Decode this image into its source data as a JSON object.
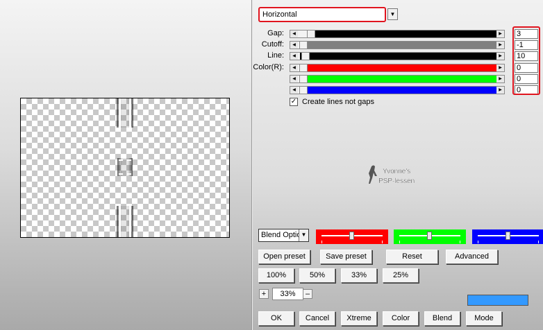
{
  "preset": {
    "selected": "Horizontal"
  },
  "sliders": [
    {
      "label": "Gap:",
      "value": "3",
      "position": 0.04,
      "fill": "#000000",
      "fill_from": "thumb"
    },
    {
      "label": "Cutoff:",
      "value": "-1",
      "position": 0.0,
      "fill": "#808080",
      "fill_from": "thumb"
    },
    {
      "label": "Line:",
      "value": "10",
      "position": 0.01,
      "fill": "#000000",
      "fill_from": "both"
    },
    {
      "label": "Color(R):",
      "value": "0",
      "position": 0.0,
      "fill": "#ff0000",
      "fill_from": "thumb"
    },
    {
      "label": "",
      "value": "0",
      "position": 0.0,
      "fill": "#00ff00",
      "fill_from": "thumb"
    },
    {
      "label": "",
      "value": "0",
      "position": 0.0,
      "fill": "#0000ff",
      "fill_from": "thumb"
    }
  ],
  "checkbox": {
    "label": "Create lines not gaps",
    "checked": true,
    "mark": "✓"
  },
  "watermark": {
    "line1": "Yvonne's",
    "line2": "PSP-lessen"
  },
  "blend": {
    "selected": "Blend Options"
  },
  "color_bars": [
    {
      "color": "#ff0000",
      "level": 0.5
    },
    {
      "color": "#00ff00",
      "level": 0.5
    },
    {
      "color": "#0000ff",
      "level": 0.5
    }
  ],
  "preset_buttons": {
    "open": "Open preset",
    "save": "Save preset",
    "reset": "Reset",
    "advanced": "Advanced"
  },
  "zoom_buttons": [
    "100%",
    "50%",
    "33%",
    "25%"
  ],
  "zoom": {
    "plus": "+",
    "minus": "–",
    "value": "33%"
  },
  "swatch_color": "#3399ff",
  "bottom_buttons": {
    "ok": "OK",
    "cancel": "Cancel",
    "xtreme": "Xtreme",
    "color": "Color",
    "blend": "Blend",
    "mode": "Mode"
  },
  "icons": {
    "dropdown": "chevron-down-icon",
    "slider_left": "arrow-left-icon",
    "slider_right": "arrow-right-icon",
    "check": "check-icon"
  }
}
